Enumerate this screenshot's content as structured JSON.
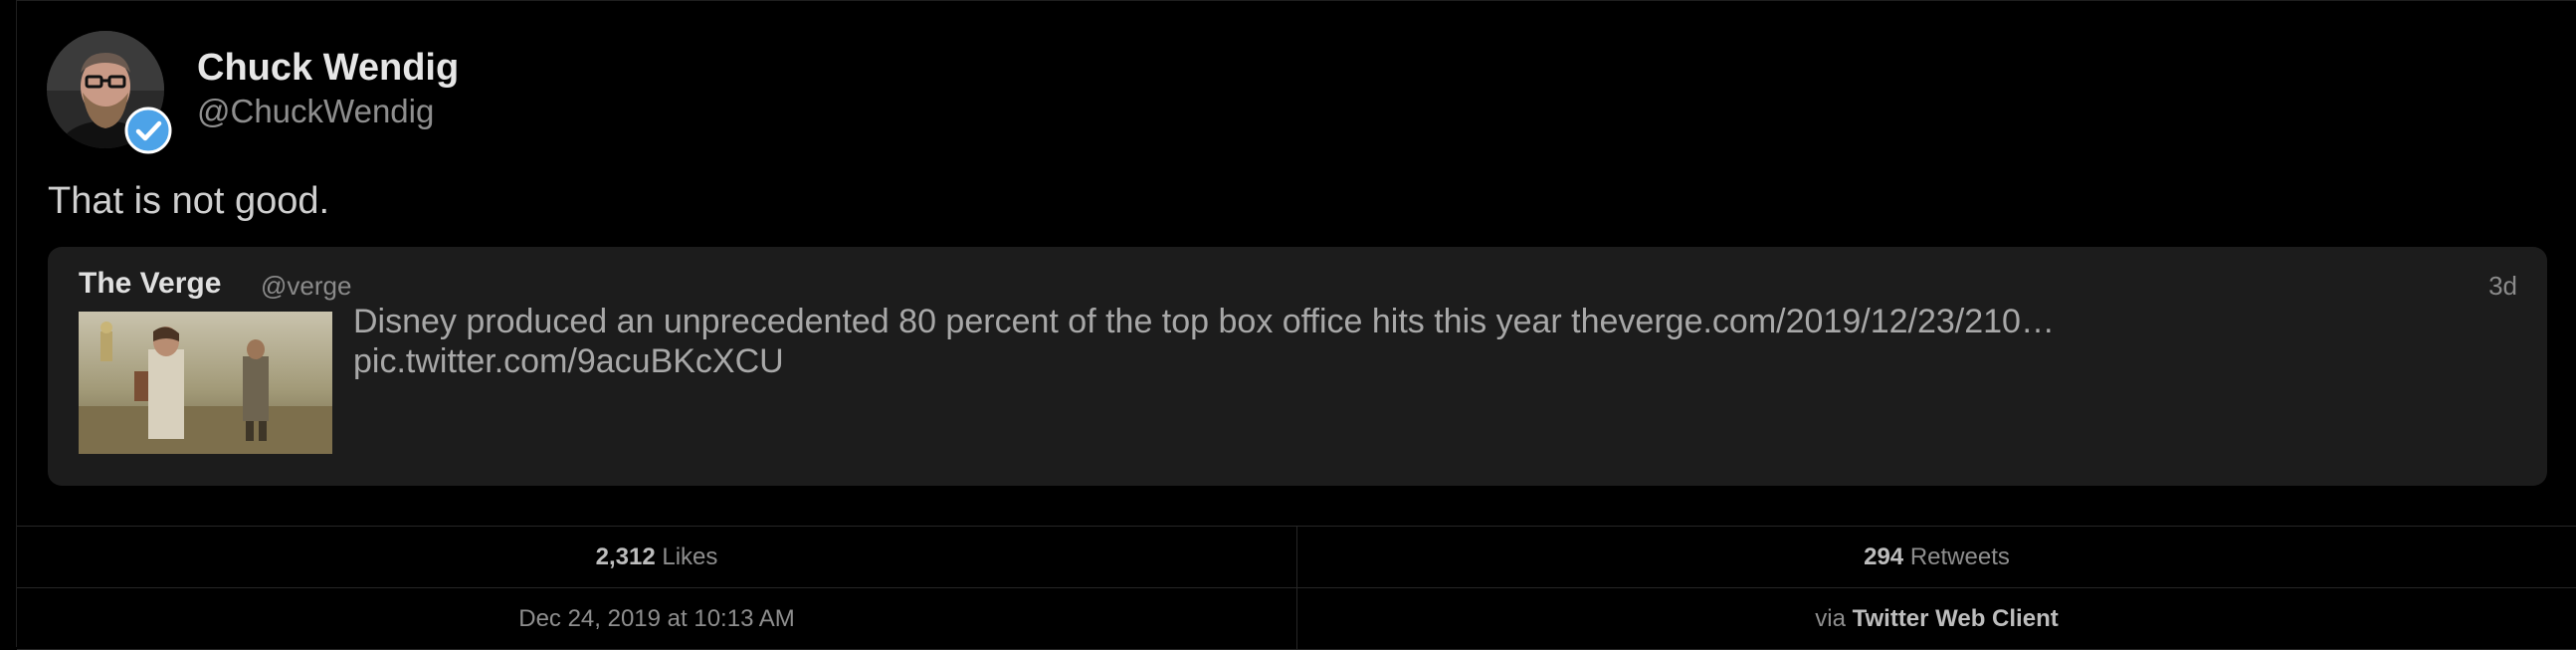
{
  "author": {
    "display_name": "Chuck Wendig",
    "handle": "@ChuckWendig",
    "verified": true,
    "verified_icon": "verified-badge-icon"
  },
  "tweet": {
    "text": "That is not good."
  },
  "quoted_tweet": {
    "author_name": "The Verge",
    "author_handle": "@verge",
    "time_ago": "3d",
    "text_line1": "Disney produced an unprecedented 80 percent of the top box office hits this year theverge.com/2019/12/23/210…",
    "text_line2": "pic.twitter.com/9acuBKcXCU"
  },
  "stats": {
    "likes_count": "2,312",
    "likes_label": "Likes",
    "retweets_count": "294",
    "retweets_label": "Retweets",
    "timestamp": "Dec 24, 2019 at 10:13 AM",
    "via_prefix": "via",
    "client": "Twitter Web Client"
  },
  "colors": {
    "background": "#000000",
    "card": "#1c1c1c",
    "verified_blue": "#4da3e8"
  }
}
